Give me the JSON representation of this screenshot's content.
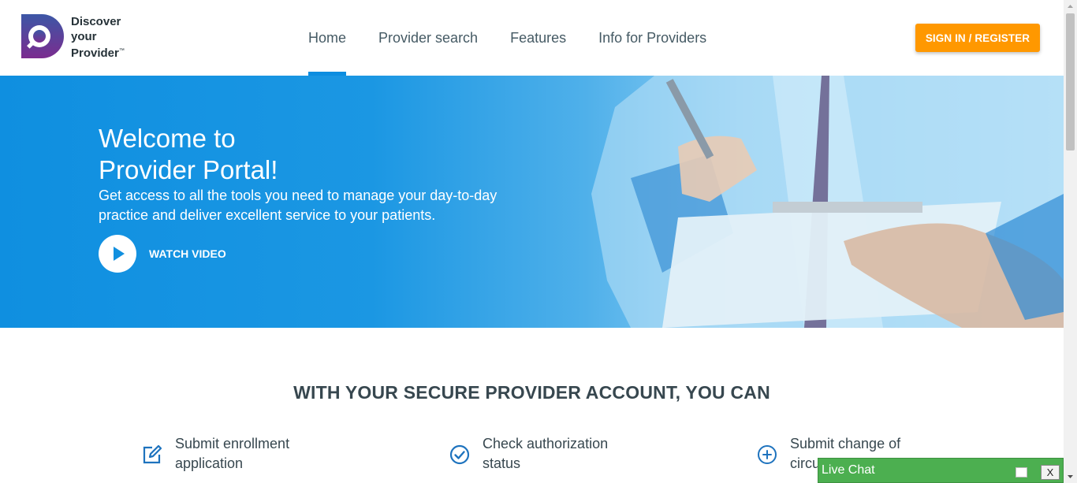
{
  "header": {
    "logo_lines": [
      "Discover",
      "your",
      "Provider"
    ],
    "logo_tm": "™",
    "nav": [
      {
        "label": "Home",
        "active": true
      },
      {
        "label": "Provider search",
        "active": false
      },
      {
        "label": "Features",
        "active": false
      },
      {
        "label": "Info for Providers",
        "active": false
      }
    ],
    "signin_label": "SIGN IN / REGISTER"
  },
  "hero": {
    "title_line1": "Welcome to",
    "title_line2": "Provider Portal!",
    "subtitle": "Get access to all the tools you need to manage your day-to-day practice and deliver excellent service to your patients.",
    "watch_label": "WATCH VIDEO"
  },
  "features": {
    "title": "WITH YOUR SECURE PROVIDER ACCOUNT, YOU CAN",
    "items": [
      {
        "icon": "edit-icon",
        "line1": "Submit enrollment",
        "line2": "application"
      },
      {
        "icon": "check-circle-icon",
        "line1": "Check authorization",
        "line2": "status"
      },
      {
        "icon": "plus-circle-icon",
        "line1": "Submit change of",
        "line2": "circumstances"
      }
    ]
  },
  "livechat": {
    "label": "Live Chat",
    "close_label": "X"
  },
  "colors": {
    "accent": "#0d8de0",
    "signin": "#ff9800",
    "logo_purple": "#5b3a96",
    "chat_green": "#4caf50"
  }
}
